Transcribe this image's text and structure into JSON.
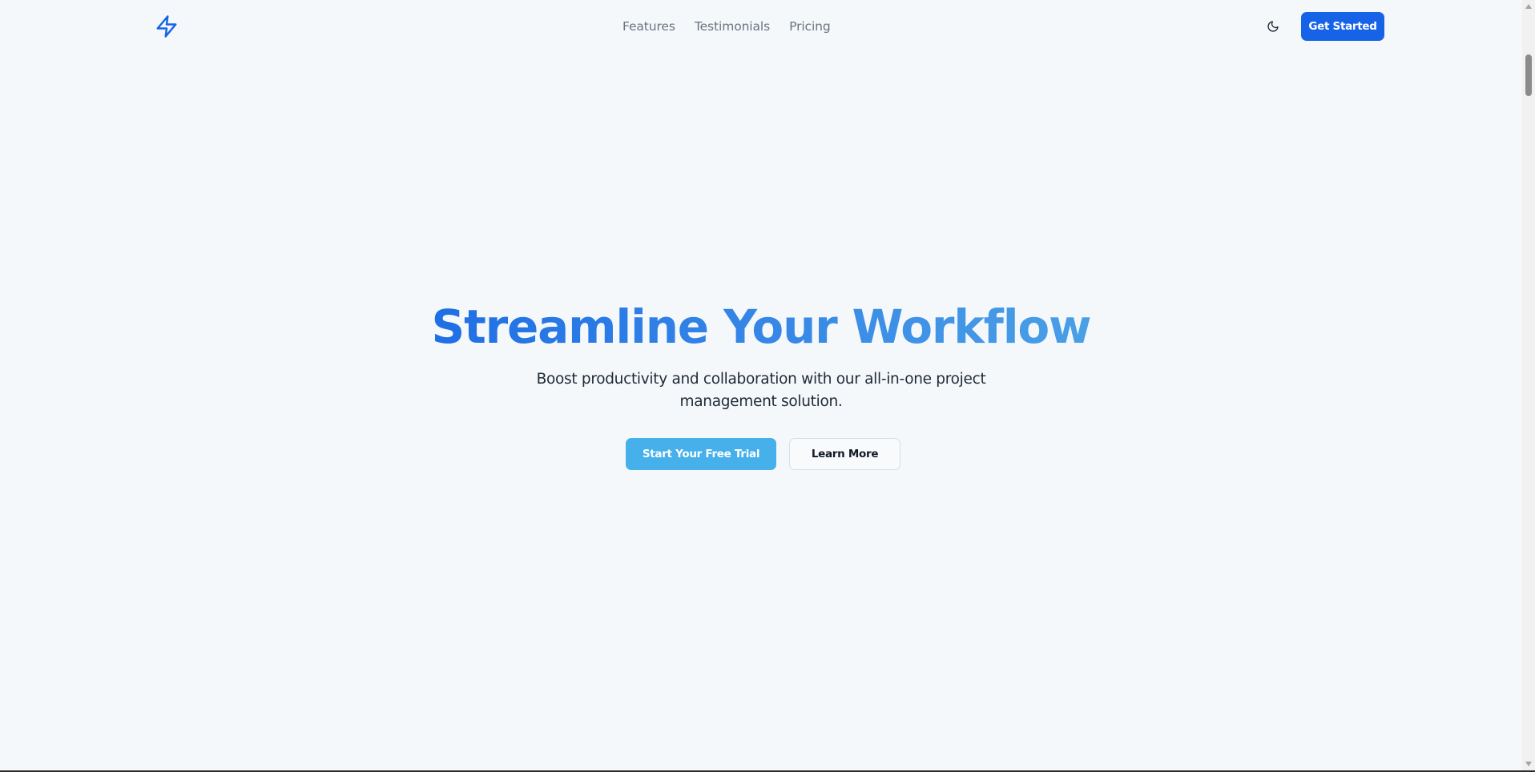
{
  "header": {
    "logo_icon": "lightning-bolt-icon",
    "nav": [
      {
        "label": "Features"
      },
      {
        "label": "Testimonials"
      },
      {
        "label": "Pricing"
      }
    ],
    "theme_toggle_icon": "moon-icon",
    "cta_label": "Get Started"
  },
  "hero": {
    "title": "Streamline Your Workflow",
    "subtitle": "Boost productivity and collaboration with our all-in-one project management solution.",
    "primary_cta": "Start Your Free Trial",
    "secondary_cta": "Learn More"
  },
  "colors": {
    "background": "#f5f8fb",
    "brand_blue": "#1763e8",
    "title_gradient_start": "#1f6fe5",
    "title_gradient_end": "#4aa0e6",
    "primary_cta": "#45b0ea",
    "nav_text": "#6b7280"
  }
}
